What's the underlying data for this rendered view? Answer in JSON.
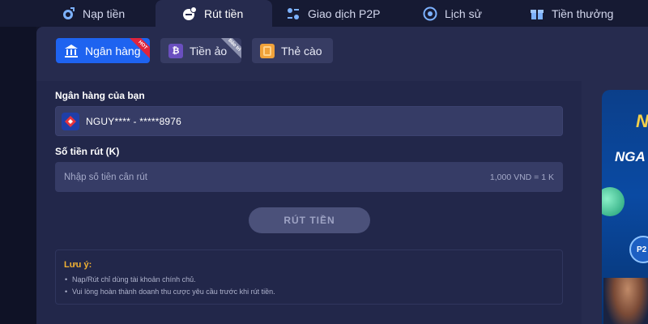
{
  "top_tabs": [
    {
      "label": "Nạp tiền",
      "icon": "deposit-icon"
    },
    {
      "label": "Rút tiền",
      "icon": "withdraw-icon",
      "active": true
    },
    {
      "label": "Giao dịch P2P",
      "icon": "p2p-icon"
    },
    {
      "label": "Lịch sử",
      "icon": "history-icon"
    },
    {
      "label": "Tiền thưởng",
      "icon": "gift-icon"
    }
  ],
  "sub_tabs": [
    {
      "label": "Ngân hàng",
      "icon": "bank-icon",
      "ribbon": "HOT",
      "active": true
    },
    {
      "label": "Tiền ảo",
      "icon": "bitcoin-icon",
      "ribbon": "Bảo trì"
    },
    {
      "label": "Thẻ cào",
      "icon": "card-icon"
    }
  ],
  "form": {
    "bank_label": "Ngân hàng của bạn",
    "bank_value": "NGUY**** - *****8976",
    "amount_label": "Số tiền rút (K)",
    "amount_placeholder": "Nhập số tiền cần rút",
    "amount_rate": "1,000 VND = 1 K",
    "submit_label": "RÚT TIỀN"
  },
  "note": {
    "title": "Lưu ý:",
    "items": [
      "Nạp/Rút chỉ dùng tài khoản chính chủ.",
      "Vui lòng hoàn thành doanh thu cược yêu cầu trước khi rút tiền."
    ]
  },
  "banner": {
    "line1": "N",
    "line2": "NGA",
    "badge": "P2"
  },
  "colors": {
    "accent": "#1e63f0",
    "panel": "#262b4e",
    "hot": "#e0243c",
    "warning": "#f2b233"
  }
}
